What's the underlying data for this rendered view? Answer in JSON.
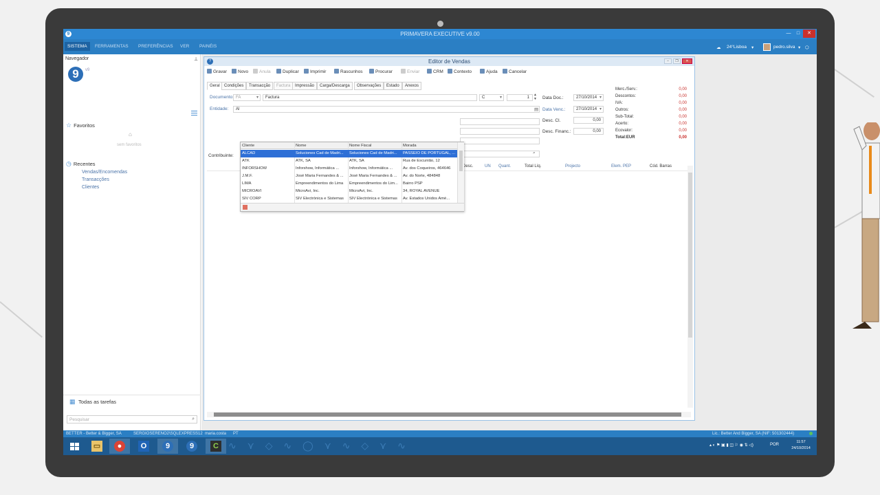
{
  "window": {
    "title": "PRIMAVERA EXECUTIVE v9.00",
    "badge": "9"
  },
  "menu": {
    "items": [
      "SISTEMA",
      "FERRAMENTAS",
      "PREFERÊNCIAS",
      "VER",
      "PAINÉIS"
    ],
    "active": "SISTEMA",
    "location": "24°Lisboa",
    "user": "pedro.silva"
  },
  "navigator": {
    "title": "Navegador",
    "logo": "9",
    "favorites_label": "Favoritos",
    "no_favorites": "sem favoritos",
    "recent_label": "Recentes",
    "recent_items": [
      "Vendas/Encomendas",
      "Transacções",
      "Clientes"
    ],
    "all_tasks": "Todas as tarefas",
    "search_placeholder": "Pesquisar"
  },
  "editor": {
    "title": "Editor de Vendas",
    "toolbar": [
      "Gravar",
      "Novo",
      "Anula",
      "Duplicar",
      "Imprimir",
      "Rascunhos",
      "Procurar",
      "Enviar",
      "CRM",
      "Contexto",
      "Ajuda",
      "Cancelar"
    ],
    "tabs": [
      "Geral",
      "Condições",
      "Transacção",
      "Factura",
      "Impressão",
      "Carga/Descarga",
      "Observações",
      "Estado",
      "Anexos"
    ],
    "documento_label": "Documento:",
    "documento_code": "FA",
    "documento_name": "Factura",
    "serie": "C",
    "numero": "1",
    "entidade_label": "Entidade:",
    "entidade_value": "Al",
    "contribuinte_label": "Contribuinte:",
    "data_doc_label": "Data Doc.:",
    "data_doc": "27/10/2014",
    "data_venc_label": "Data Venc.:",
    "data_venc": "27/10/2014",
    "desc_cl_label": "Desc. Cl.",
    "desc_cl": "0,00",
    "desc_financ_label": "Desc. Financ.:",
    "desc_financ": "0,00"
  },
  "totals": [
    {
      "label": "Merc./Serv.:",
      "value": "0,00"
    },
    {
      "label": "Descontos:",
      "value": "0,00"
    },
    {
      "label": "IVA:",
      "value": "0,00"
    },
    {
      "label": "Outros:",
      "value": "0,00"
    },
    {
      "label": "Sub-Total:",
      "value": "0,00"
    },
    {
      "label": "Acerto:",
      "value": "0,00"
    },
    {
      "label": "Ecovalor:",
      "value": "0,00"
    },
    {
      "label": "Total:EUR",
      "value": "0,00"
    }
  ],
  "dropdown": {
    "columns": [
      "Cliente",
      "Nome",
      "Nome Fiscal",
      "Morada"
    ],
    "rows": [
      [
        "ALCAD",
        "Soluciones Cad de Madri...",
        "Soluciones Cad de Madri...",
        "PASSEIO DE PORTUGAL, ..."
      ],
      [
        "ATK",
        "ATK, SA",
        "ATK, SA",
        "Rua de Escunião, 12"
      ],
      [
        "INFORSHOW",
        "Inforshow, Informática ...",
        "Inforshow, Informática ...",
        "Av. dos Coqueiros, 464646"
      ],
      [
        "J.M.F.",
        "José Maria Fernandes & ...",
        "José Maria Fernandes & ...",
        "Av. do Norte, 484848"
      ],
      [
        "LIMA",
        "Empreendimentos do Lima",
        "Empreendimentos do Lim...",
        "Bairro PSP"
      ],
      [
        "MICROAVI",
        "MicroAvi, Inc.",
        "MicroAvi, Inc.",
        "34, ROYAL AVENUE"
      ],
      [
        "SIV CORP",
        "SIV Electrónica e Sistemas",
        "SIV Electrónica e Sistemas",
        "Av. Estados Unidos Amé..."
      ]
    ],
    "selected_index": 0
  },
  "grid_columns": [
    "Desc.",
    "UN",
    "Quant.",
    "Total Líq.",
    "Projecto",
    "Elem. PEP",
    "Cód. Barras"
  ],
  "status": {
    "company": "BETTER - Better & Bigger, SA",
    "server": "SERGIOSERENO2\\SQLEXPRESS12",
    "user": "maria.costa",
    "lang": "PT",
    "license": "Lic.: Better And Bigger, SA (NIF: 501302444)"
  },
  "taskbar": {
    "lang": "POR",
    "time": "11:57",
    "date": "24/10/2014"
  }
}
